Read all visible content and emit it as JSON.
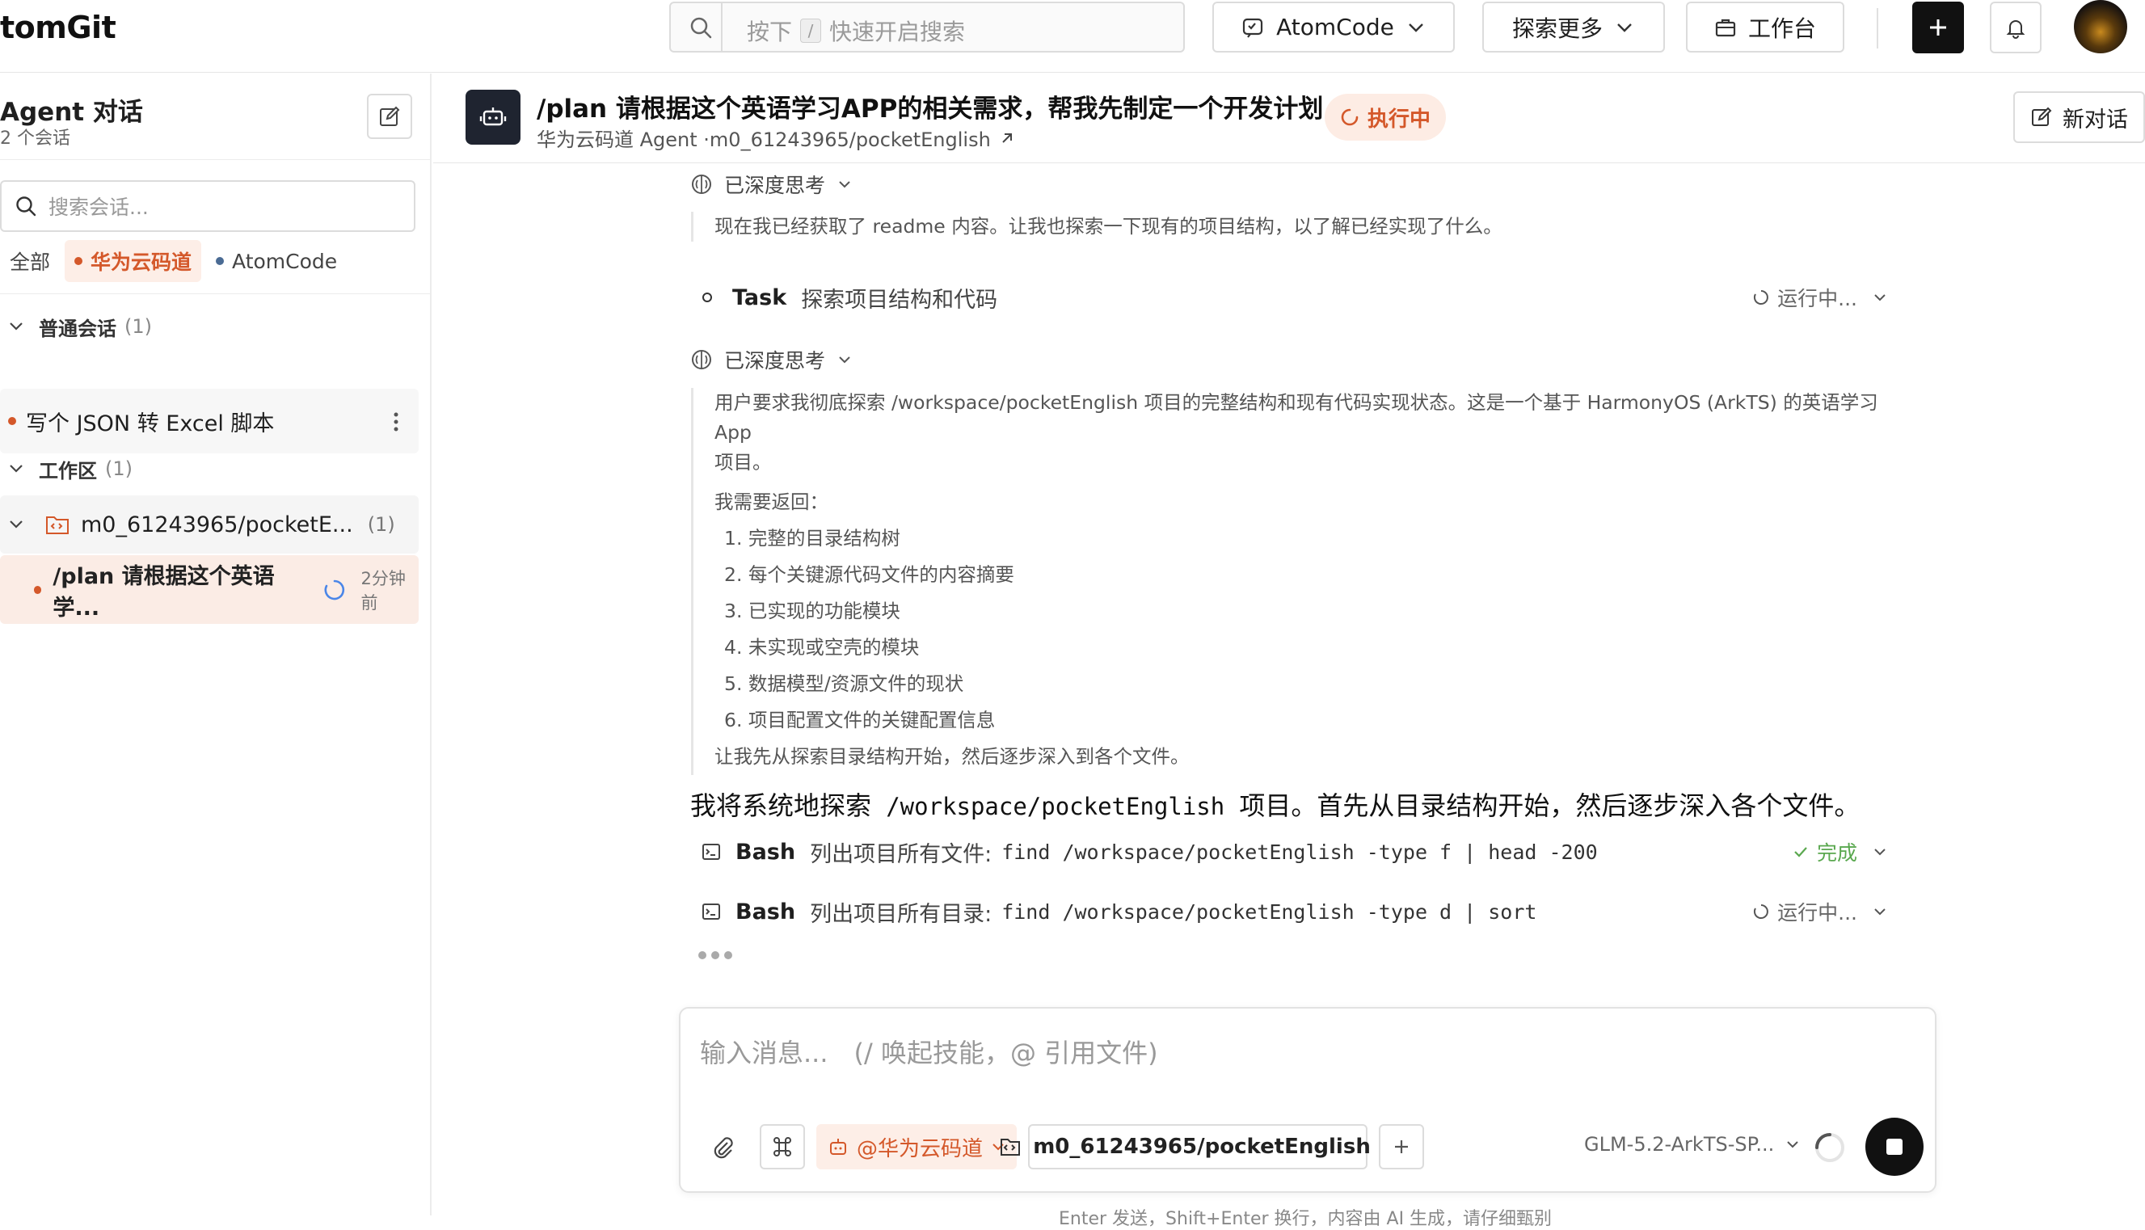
{
  "topbar": {
    "logo": "tomGit",
    "search_placeholder_prefix": "按下",
    "search_key": "/",
    "search_placeholder_suffix": "快速开启搜索",
    "atomcode_label": "AtomCode",
    "explore_label": "探索更多",
    "workbench_label": "工作台"
  },
  "sidebar": {
    "title": "Agent 对话",
    "session_count": "2 个会话",
    "search_placeholder": "搜索会话...",
    "filters": [
      {
        "label": "全部"
      },
      {
        "label": "华为云码道"
      },
      {
        "label": "AtomCode"
      }
    ],
    "groups": [
      {
        "label": "普通会话",
        "count": "(1)"
      },
      {
        "label": "工作区",
        "count": "(1)"
      }
    ],
    "conversations": [
      {
        "label": "写个 JSON 转 Excel 脚本"
      }
    ],
    "workspace": {
      "label": "m0_61243965/pocketE...",
      "count": "(1)"
    },
    "workspace_conversation": {
      "label": "/plan 请根据这个英语学...",
      "time": "2分钟前"
    }
  },
  "header": {
    "title": "/plan 请根据这个英语学习APP的相关需求，帮我先制定一个开发计划",
    "subtitle": "华为云码道 Agent ·m0_61243965/pocketEnglish",
    "status": "执行中",
    "new_chat": "新对话"
  },
  "content": {
    "think1_label": "已深度思考",
    "think1_text": "现在我已经获取了 readme 内容。让我也探索一下现有的项目结构，以了解已经实现了什么。",
    "task1": {
      "type": "Task",
      "desc": "探索项目结构和代码",
      "status": "运行中..."
    },
    "think2_label": "已深度思考",
    "think2_lines": [
      "用户要求我彻底探索 /workspace/pocketEnglish 项目的完整结构和现有代码实现状态。这是一个基于 HarmonyOS (ArkTS) 的英语学习 App",
      "项目。",
      "我需要返回：",
      "1. 完整的目录结构树",
      "2. 每个关键源代码文件的内容摘要",
      "3. 已实现的功能模块",
      "4. 未实现或空壳的模块",
      "5. 数据模型/资源文件的现状",
      "6. 项目配置文件的关键配置信息",
      "让我先从探索目录结构开始，然后逐步深入到各个文件。"
    ],
    "message_prefix": "我将系统地探索",
    "message_path": "/workspace/pocketEnglish",
    "message_suffix": "项目。首先从目录结构开始，然后逐步深入各个文件。",
    "bash1": {
      "type": "Bash",
      "desc": "列出项目所有文件:",
      "cmd": "find /workspace/pocketEnglish -type f | head -200",
      "status": "完成"
    },
    "bash2": {
      "type": "Bash",
      "desc": "列出项目所有目录:",
      "cmd": "find /workspace/pocketEnglish -type d | sort",
      "status": "运行中..."
    }
  },
  "composer": {
    "placeholder": "输入消息...　(/ 唤起技能，@ 引用文件)",
    "agent_label": "@华为云码道",
    "repo_label": "m0_61243965/pocketEnglish",
    "model_label": "GLM-5.2-ArkTS-SP...",
    "footer_hint": "Enter 发送，Shift+Enter 换行，内容由 AI 生成，请仔细甄别"
  },
  "colors": {
    "accent": "#d4582a",
    "accent_bg": "#fdeee7",
    "success": "#5aa84f",
    "dark": "#111111",
    "link": "#4a86e8"
  }
}
